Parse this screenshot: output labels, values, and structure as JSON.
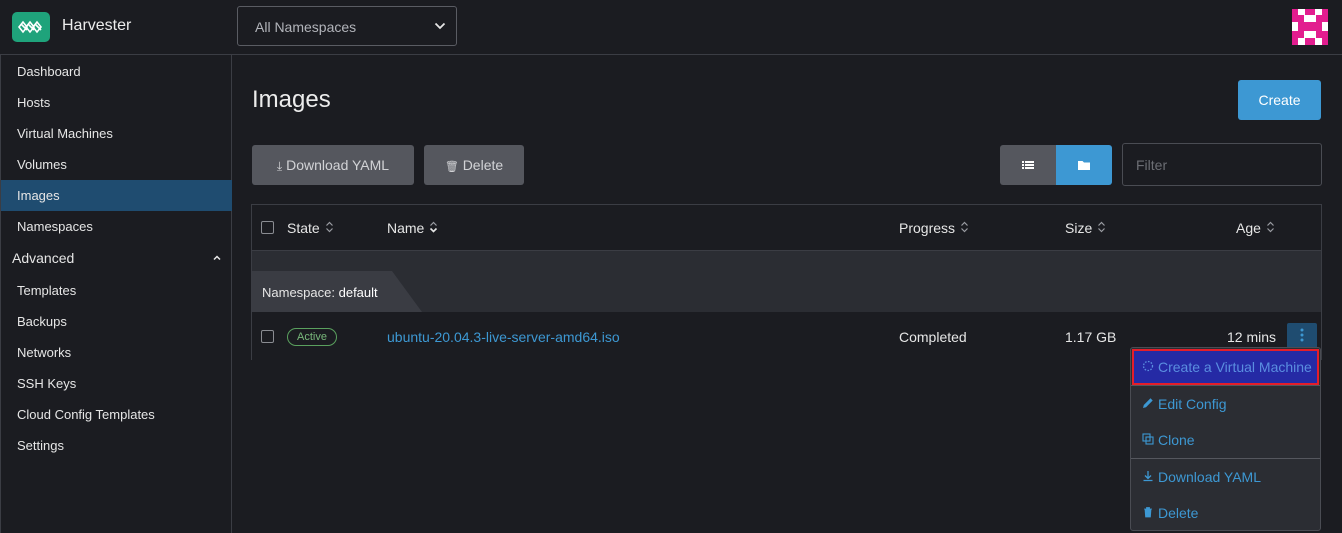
{
  "app": {
    "title": "Harvester"
  },
  "namespace_select": {
    "value": "All Namespaces"
  },
  "sidebar": {
    "items": [
      {
        "label": "Dashboard"
      },
      {
        "label": "Hosts"
      },
      {
        "label": "Virtual Machines"
      },
      {
        "label": "Volumes"
      },
      {
        "label": "Images",
        "active": true
      },
      {
        "label": "Namespaces"
      }
    ],
    "group": {
      "label": "Advanced",
      "expanded": true
    },
    "advanced_items": [
      {
        "label": "Templates"
      },
      {
        "label": "Backups"
      },
      {
        "label": "Networks"
      },
      {
        "label": "SSH Keys"
      },
      {
        "label": "Cloud Config Templates"
      },
      {
        "label": "Settings"
      }
    ]
  },
  "main": {
    "title": "Images",
    "create_label": "Create",
    "download_yaml_label": "Download YAML",
    "delete_label": "Delete",
    "filter_placeholder": "Filter"
  },
  "table": {
    "headers": {
      "state": "State",
      "name": "Name",
      "progress": "Progress",
      "size": "Size",
      "age": "Age"
    },
    "group": {
      "prefix": "Namespace:",
      "name": "default"
    },
    "rows": [
      {
        "state": "Active",
        "name": "ubuntu-20.04.3-live-server-amd64.iso",
        "progress": "Completed",
        "size": "1.17 GB",
        "age": "12 mins"
      }
    ]
  },
  "context_menu": {
    "items": [
      {
        "label": "Create a Virtual Machine",
        "icon": "spinner-icon"
      },
      {
        "label": "Edit Config",
        "icon": "pencil-icon"
      },
      {
        "label": "Clone",
        "icon": "copy-icon"
      },
      {
        "label": "Download YAML",
        "icon": "download-icon"
      },
      {
        "label": "Delete",
        "icon": "trash-icon"
      }
    ]
  },
  "colors": {
    "accent": "#3d98d3",
    "brand": "#1fa37b",
    "active_nav": "#1f4c70",
    "highlight_outline": "#e51e2a"
  }
}
